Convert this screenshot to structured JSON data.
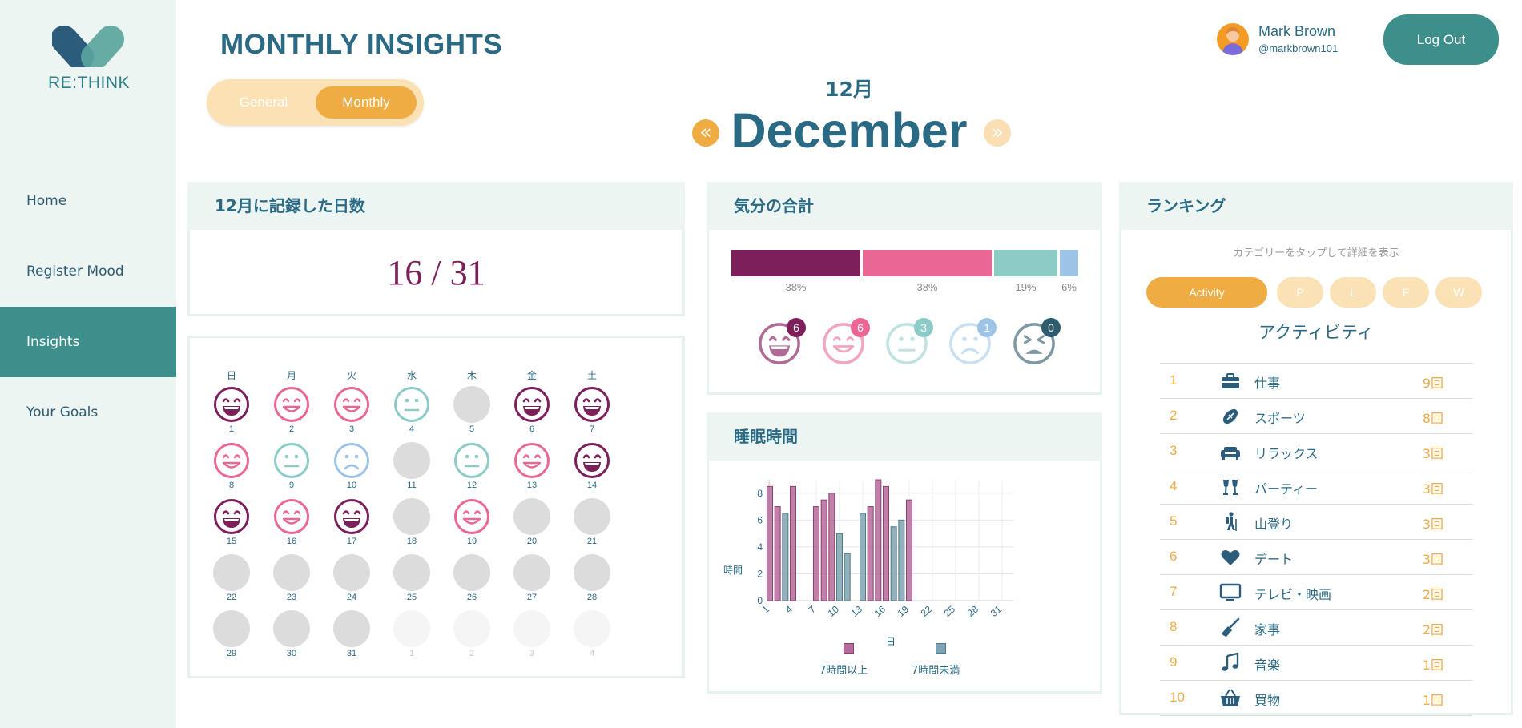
{
  "app": {
    "logo_text": "RE:THINK",
    "page_title": "MONTHLY INSIGHTS"
  },
  "nav": [
    {
      "label": "Home",
      "active": false
    },
    {
      "label": "Register Mood",
      "active": false
    },
    {
      "label": "Insights",
      "active": true
    },
    {
      "label": "Your Goals",
      "active": false
    }
  ],
  "toggle": {
    "general": "General",
    "monthly": "Monthly",
    "selected": "Monthly"
  },
  "month": {
    "jp": "12月",
    "en": "December",
    "prev_icon": "«",
    "next_icon": "»"
  },
  "user": {
    "name": "Mark Brown",
    "handle": "@markbrown101",
    "logout": "Log Out"
  },
  "record_card": {
    "title": "12月に記録した日数",
    "count": "16 / 31"
  },
  "calendar": {
    "weekdays": [
      "日",
      "月",
      "火",
      "水",
      "木",
      "金",
      "土"
    ],
    "days": [
      {
        "n": "1",
        "mood": "great"
      },
      {
        "n": "2",
        "mood": "good"
      },
      {
        "n": "3",
        "mood": "good"
      },
      {
        "n": "4",
        "mood": "neutral"
      },
      {
        "n": "5",
        "mood": "none"
      },
      {
        "n": "6",
        "mood": "great"
      },
      {
        "n": "7",
        "mood": "great"
      },
      {
        "n": "8",
        "mood": "good"
      },
      {
        "n": "9",
        "mood": "neutral"
      },
      {
        "n": "10",
        "mood": "sad"
      },
      {
        "n": "11",
        "mood": "none"
      },
      {
        "n": "12",
        "mood": "neutral"
      },
      {
        "n": "13",
        "mood": "good"
      },
      {
        "n": "14",
        "mood": "great"
      },
      {
        "n": "15",
        "mood": "great"
      },
      {
        "n": "16",
        "mood": "good"
      },
      {
        "n": "17",
        "mood": "great"
      },
      {
        "n": "18",
        "mood": "none"
      },
      {
        "n": "19",
        "mood": "good"
      },
      {
        "n": "20",
        "mood": "none"
      },
      {
        "n": "21",
        "mood": "none"
      },
      {
        "n": "22",
        "mood": "none"
      },
      {
        "n": "23",
        "mood": "none"
      },
      {
        "n": "24",
        "mood": "none"
      },
      {
        "n": "25",
        "mood": "none"
      },
      {
        "n": "26",
        "mood": "none"
      },
      {
        "n": "27",
        "mood": "none"
      },
      {
        "n": "28",
        "mood": "none"
      },
      {
        "n": "29",
        "mood": "none"
      },
      {
        "n": "30",
        "mood": "none"
      },
      {
        "n": "31",
        "mood": "none"
      },
      {
        "n": "1",
        "mood": "out"
      },
      {
        "n": "2",
        "mood": "out"
      },
      {
        "n": "3",
        "mood": "out"
      },
      {
        "n": "4",
        "mood": "out"
      }
    ]
  },
  "mood_card": {
    "title": "気分の合計",
    "segments": [
      {
        "key": "great",
        "pct": "38%",
        "value": 38,
        "color": "#7c1f5a",
        "count": "6"
      },
      {
        "key": "good",
        "pct": "38%",
        "value": 38,
        "color": "#ea6694",
        "count": "6"
      },
      {
        "key": "neutral",
        "pct": "19%",
        "value": 19,
        "color": "#8ccbc6",
        "count": "3"
      },
      {
        "key": "sad",
        "pct": "6%",
        "value": 6,
        "color": "#9dc3e6",
        "count": "1"
      }
    ],
    "faces": [
      {
        "key": "great",
        "color": "#b06a96",
        "badge_color": "#7c1f5a",
        "count": "6"
      },
      {
        "key": "good",
        "color": "#f3a5c0",
        "badge_color": "#ea6694",
        "count": "6"
      },
      {
        "key": "neutral",
        "color": "#bfe3e0",
        "badge_color": "#8ccbc6",
        "count": "3"
      },
      {
        "key": "sad",
        "color": "#c9dff2",
        "badge_color": "#9dc3e6",
        "count": "1"
      },
      {
        "key": "awful",
        "color": "#7d98a3",
        "badge_color": "#2c5c6e",
        "count": "0"
      }
    ]
  },
  "sleep_card": {
    "title": "睡眠時間"
  },
  "chart_data": {
    "type": "bar",
    "x": [
      1,
      2,
      3,
      4,
      5,
      6,
      7,
      8,
      9,
      10,
      11,
      12,
      13,
      14,
      15,
      16,
      17,
      18,
      19,
      20,
      21,
      22,
      23,
      24,
      25,
      26,
      27,
      28,
      29,
      30,
      31
    ],
    "series": [
      {
        "name": "7時間以上",
        "color": "#b46a9a",
        "values": [
          8.5,
          7,
          null,
          8.5,
          null,
          null,
          7,
          7.5,
          8,
          null,
          null,
          null,
          null,
          7,
          9,
          8.5,
          null,
          null,
          7.5,
          null,
          null,
          null,
          null,
          null,
          null,
          null,
          null,
          null,
          null,
          null,
          null
        ]
      },
      {
        "name": "7時間未満",
        "color": "#7fa3b0",
        "values": [
          null,
          null,
          6.5,
          null,
          null,
          null,
          null,
          null,
          null,
          5,
          3.5,
          null,
          6.5,
          null,
          null,
          null,
          5.5,
          6,
          null,
          null,
          null,
          null,
          null,
          null,
          null,
          null,
          null,
          null,
          null,
          null,
          null
        ]
      }
    ],
    "xticks": [
      "1",
      "4",
      "7",
      "10",
      "13",
      "16",
      "19",
      "22",
      "25",
      "28",
      "31"
    ],
    "yticks": [
      "0",
      "2",
      "4",
      "6",
      "8"
    ],
    "xlabel": "日",
    "ylabel": "時間",
    "ylim": [
      0,
      9
    ],
    "grid": true,
    "legend": "bottom"
  },
  "ranking": {
    "title": "ランキング",
    "hint": "カテゴリーをタップして詳細を表示",
    "chips": [
      {
        "label": "Activity",
        "active": true
      },
      {
        "label": "P",
        "active": false
      },
      {
        "label": "L",
        "active": false
      },
      {
        "label": "F",
        "active": false
      },
      {
        "label": "W",
        "active": false
      }
    ],
    "subtitle": "アクティビティ",
    "rows": [
      {
        "no": "1",
        "icon": "briefcase-icon",
        "name": "仕事",
        "count": "9回"
      },
      {
        "no": "2",
        "icon": "football-icon",
        "name": "スポーツ",
        "count": "8回"
      },
      {
        "no": "3",
        "icon": "couch-icon",
        "name": "リラックス",
        "count": "3回"
      },
      {
        "no": "4",
        "icon": "glasses-toast-icon",
        "name": "パーティー",
        "count": "3回"
      },
      {
        "no": "5",
        "icon": "hiking-icon",
        "name": "山登り",
        "count": "3回"
      },
      {
        "no": "6",
        "icon": "heart-icon",
        "name": "デート",
        "count": "3回"
      },
      {
        "no": "7",
        "icon": "tv-icon",
        "name": "テレビ・映画",
        "count": "2回"
      },
      {
        "no": "8",
        "icon": "broom-icon",
        "name": "家事",
        "count": "2回"
      },
      {
        "no": "9",
        "icon": "music-icon",
        "name": "音楽",
        "count": "1回"
      },
      {
        "no": "10",
        "icon": "basket-icon",
        "name": "買物",
        "count": "1回"
      }
    ]
  }
}
